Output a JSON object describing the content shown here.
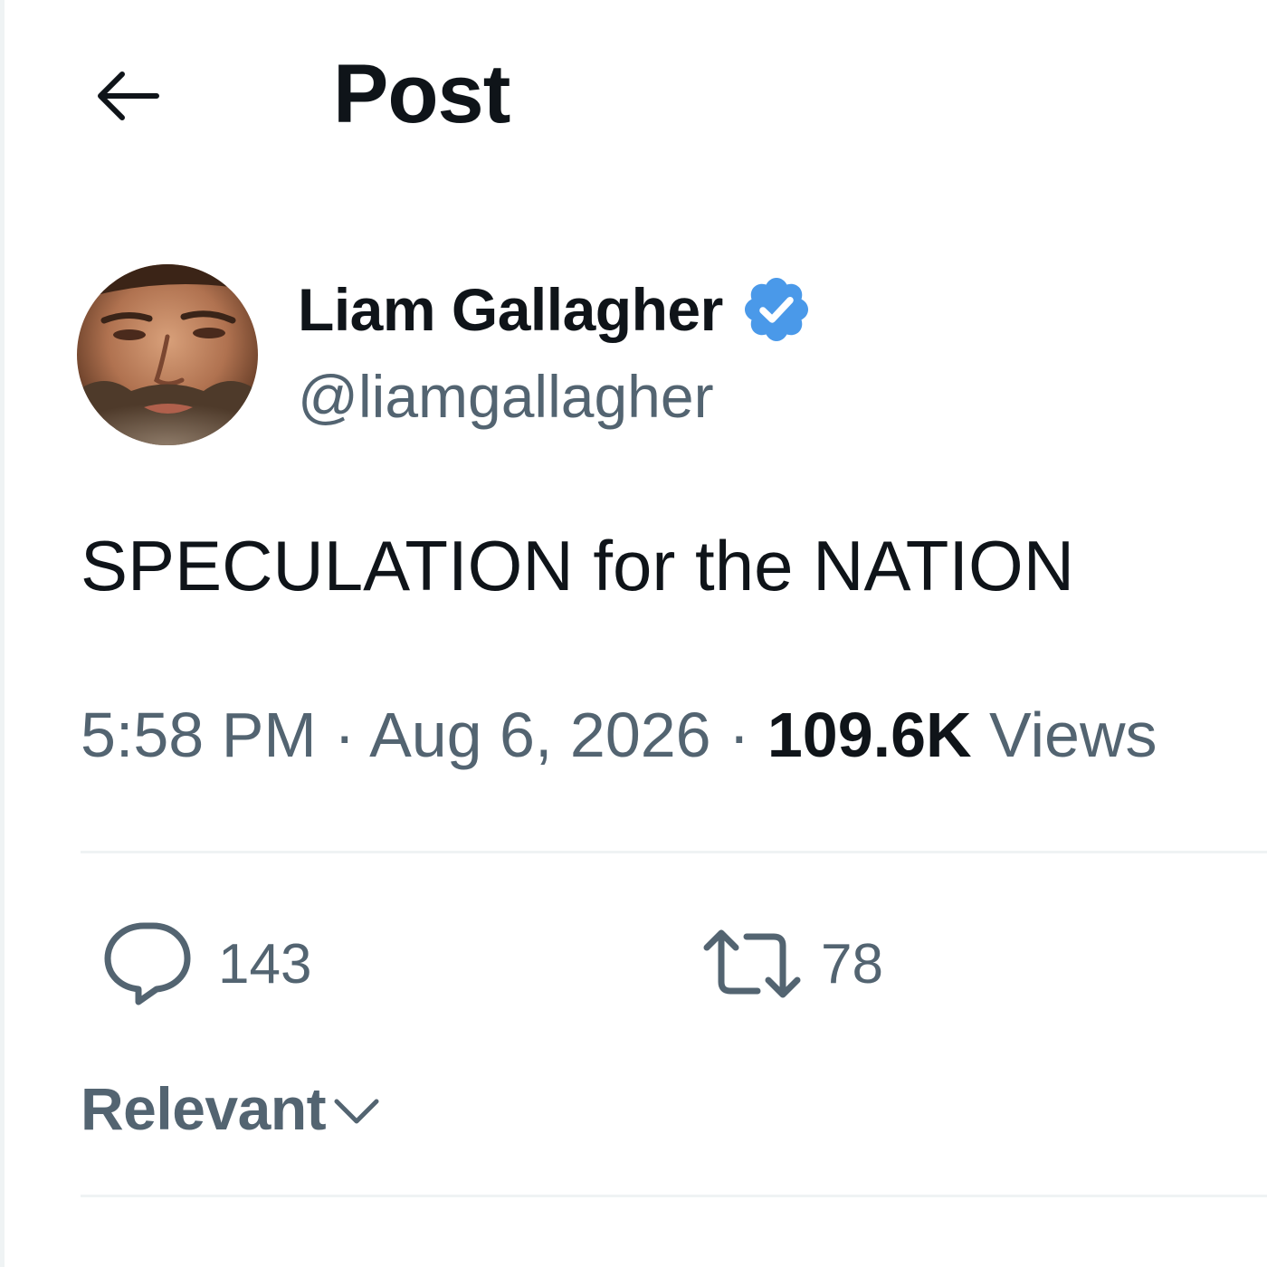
{
  "header": {
    "back_label": "Back",
    "title": "Post"
  },
  "post": {
    "author": {
      "display_name": "Liam Gallagher",
      "handle": "@liamgallagher",
      "verified": true,
      "verified_color": "#4a99e9"
    },
    "text": "SPECULATION for the NATION",
    "time": "5:58 PM",
    "separator": "·",
    "date": "Aug 6, 2026",
    "views_count": "109.6K",
    "views_label": "Views",
    "actions": {
      "reply_count": "143",
      "repost_count": "78"
    }
  },
  "replies": {
    "sort_label": "Relevant"
  },
  "colors": {
    "text_primary": "#0f1419",
    "text_secondary": "#536471",
    "divider": "#eff3f4",
    "verified_badge": "#4a99e9"
  },
  "icons": {
    "back": "arrow-left-icon",
    "verified": "verified-badge-icon",
    "reply": "speech-bubble-icon",
    "repost": "repost-arrows-icon",
    "sort": "chevron-down-icon"
  }
}
